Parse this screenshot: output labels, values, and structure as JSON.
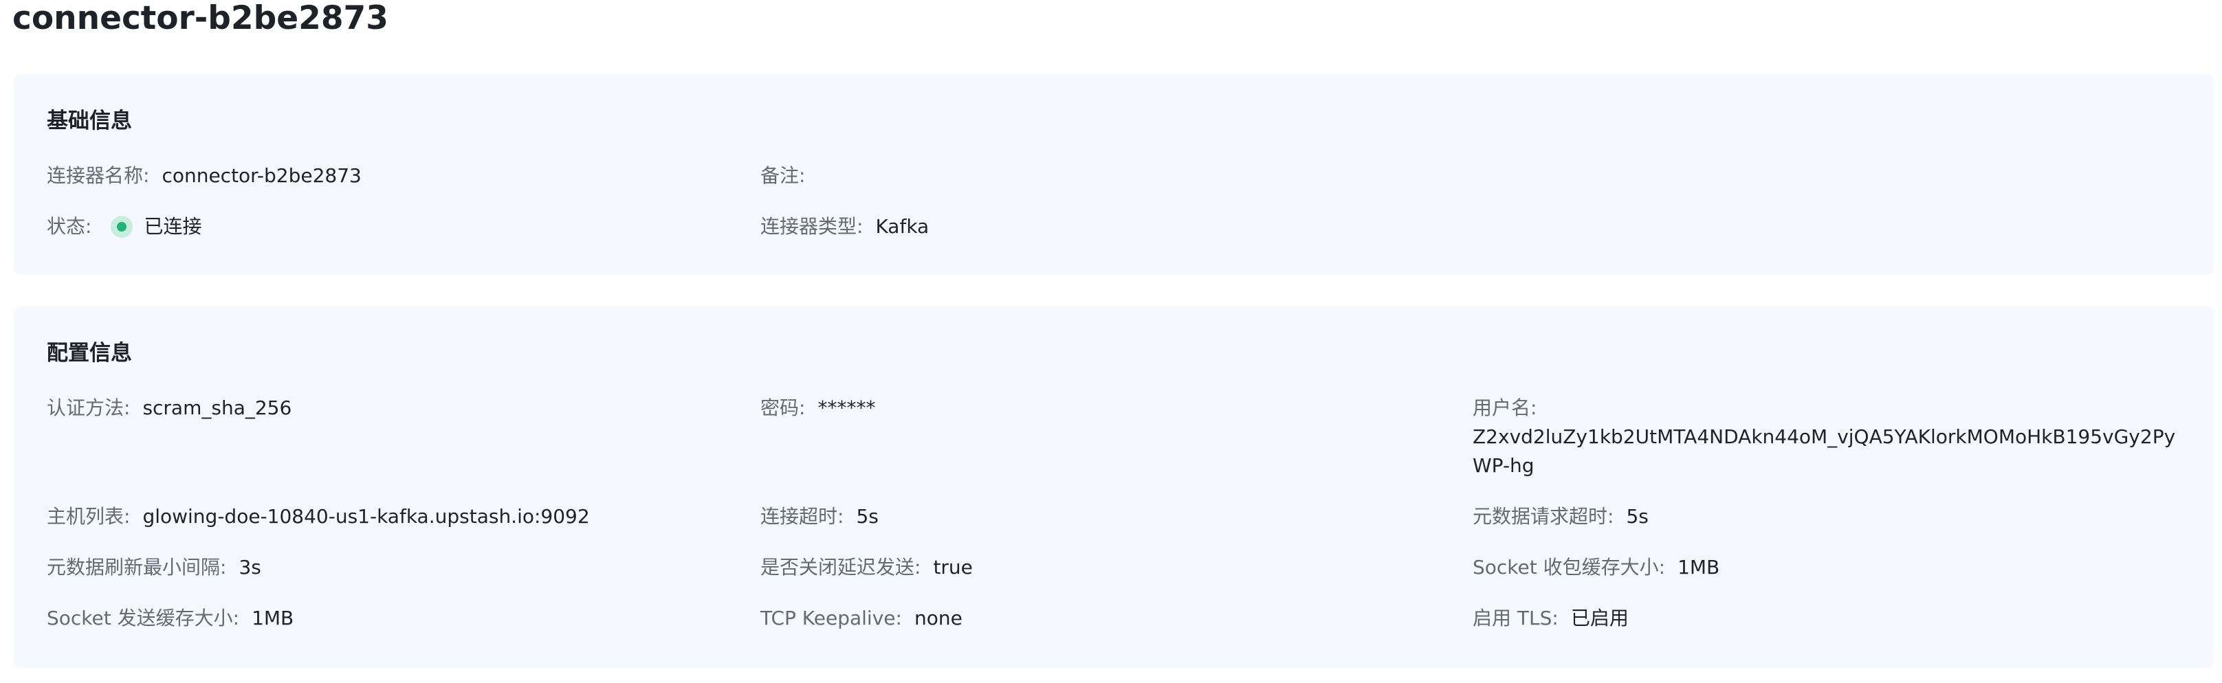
{
  "page": {
    "title": "connector-b2be2873"
  },
  "basic_info": {
    "title": "基础信息",
    "connector_name": {
      "label": "连接器名称:",
      "value": "connector-b2be2873"
    },
    "remark": {
      "label": "备注:",
      "value": ""
    },
    "status": {
      "label": "状态:",
      "value": "已连接",
      "color": "#1fb27a"
    },
    "connector_type": {
      "label": "连接器类型:",
      "value": "Kafka"
    }
  },
  "config_info": {
    "title": "配置信息",
    "auth_method": {
      "label": "认证方法:",
      "value": "scram_sha_256"
    },
    "password": {
      "label": "密码:",
      "value": "******"
    },
    "username": {
      "label": "用户名:",
      "value": "Z2xvd2luZy1kb2UtMTA4NDAkn44oM_vjQA5YAKlorkMOMoHkB195vGy2PyWP-hg"
    },
    "host_list": {
      "label": "主机列表:",
      "value": "glowing-doe-10840-us1-kafka.upstash.io:9092"
    },
    "connect_timeout": {
      "label": "连接超时:",
      "value": "5s"
    },
    "metadata_request_timeout": {
      "label": "元数据请求超时:",
      "value": "5s"
    },
    "metadata_refresh_min_interval": {
      "label": "元数据刷新最小间隔:",
      "value": "3s"
    },
    "disable_nagle": {
      "label": "是否关闭延迟发送:",
      "value": "true"
    },
    "socket_recv_buffer": {
      "label": "Socket 收包缓存大小:",
      "value": "1MB"
    },
    "socket_send_buffer": {
      "label": "Socket 发送缓存大小:",
      "value": "1MB"
    },
    "tcp_keepalive": {
      "label": "TCP Keepalive:",
      "value": "none"
    },
    "enable_tls": {
      "label": "启用 TLS:",
      "value": "已启用"
    }
  }
}
